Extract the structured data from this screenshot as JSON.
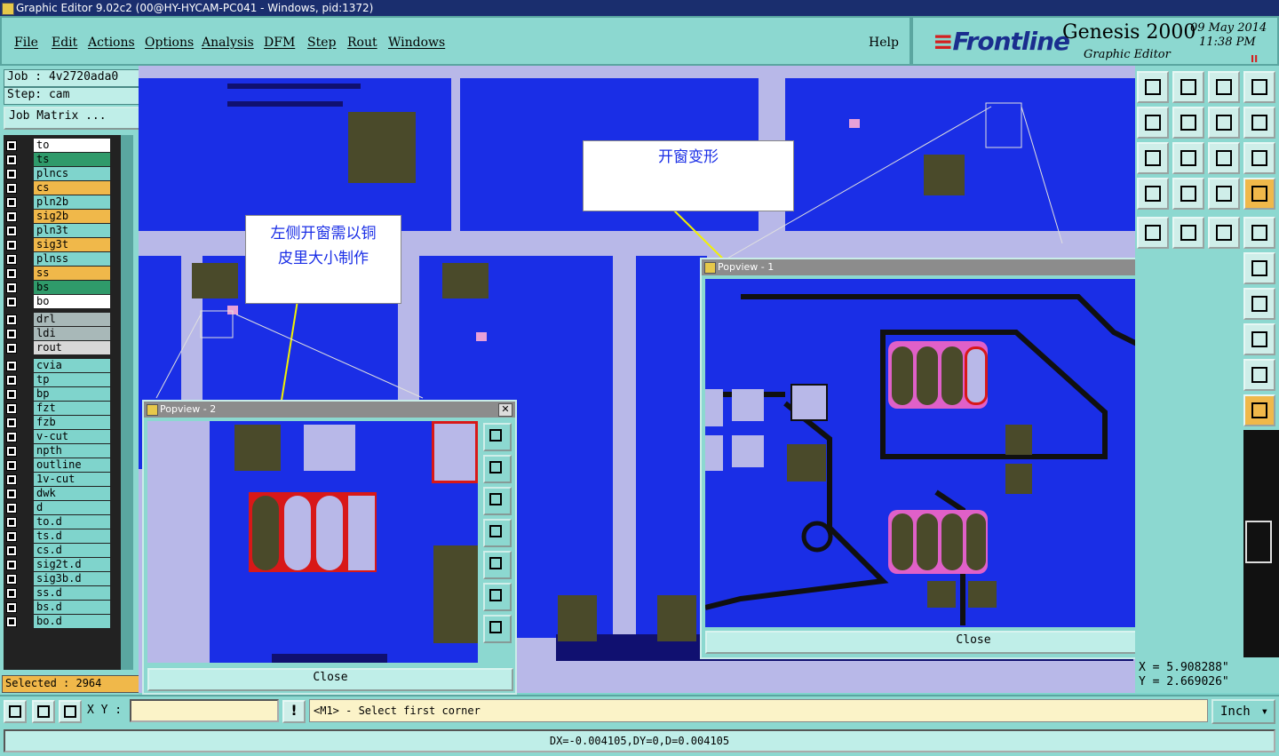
{
  "window": {
    "title": "Graphic Editor 9.02c2 (00@HY-HYCAM-PC041 - Windows, pid:1372)"
  },
  "menu": [
    {
      "label": "File"
    },
    {
      "label": "Edit"
    },
    {
      "label": "Actions"
    },
    {
      "label": "Options"
    },
    {
      "label": "Analysis"
    },
    {
      "label": "DFM"
    },
    {
      "label": "Step"
    },
    {
      "label": "Rout"
    },
    {
      "label": "Windows"
    },
    {
      "label": "Help"
    }
  ],
  "brand": {
    "logo": "Frontline",
    "product": "Genesis 2000",
    "subtitle": "Graphic Editor",
    "date": "09 May 2014",
    "time": "11:38 PM",
    "pause": "II"
  },
  "job": {
    "job_label": "Job : 4v2720ada0",
    "step_label": "Step: cam",
    "matrix_button": "Job Matrix ..."
  },
  "layers": [
    {
      "name": "to",
      "color": "#ffffff"
    },
    {
      "name": "ts",
      "color": "#2f9a6a"
    },
    {
      "name": "plncs",
      "color": "#7fd4cc"
    },
    {
      "name": "cs",
      "color": "#f0b84a"
    },
    {
      "name": "pln2b",
      "color": "#7fd4cc"
    },
    {
      "name": "sig2b",
      "color": "#f0b84a"
    },
    {
      "name": "pln3t",
      "color": "#7fd4cc"
    },
    {
      "name": "sig3t",
      "color": "#f0b84a"
    },
    {
      "name": "plnss",
      "color": "#7fd4cc"
    },
    {
      "name": "ss",
      "color": "#f0b84a"
    },
    {
      "name": "bs",
      "color": "#2f9a6a"
    },
    {
      "name": "bo",
      "color": "#ffffff"
    },
    {
      "name": "drl",
      "color": "#a8b8b8"
    },
    {
      "name": "ldi",
      "color": "#a8b8b8"
    },
    {
      "name": "rout",
      "color": "#d8d8d8"
    },
    {
      "name": "cvia",
      "color": "#7fd4cc"
    },
    {
      "name": "tp",
      "color": "#7fd4cc"
    },
    {
      "name": "bp",
      "color": "#7fd4cc"
    },
    {
      "name": "fzt",
      "color": "#7fd4cc"
    },
    {
      "name": "fzb",
      "color": "#7fd4cc"
    },
    {
      "name": "v-cut",
      "color": "#7fd4cc"
    },
    {
      "name": "npth",
      "color": "#7fd4cc"
    },
    {
      "name": "outline",
      "color": "#7fd4cc"
    },
    {
      "name": "1v-cut",
      "color": "#7fd4cc"
    },
    {
      "name": "dwk",
      "color": "#7fd4cc"
    },
    {
      "name": "d",
      "color": "#7fd4cc"
    },
    {
      "name": "to.d",
      "color": "#7fd4cc"
    },
    {
      "name": "ts.d",
      "color": "#7fd4cc"
    },
    {
      "name": "cs.d",
      "color": "#7fd4cc"
    },
    {
      "name": "sig2t.d",
      "color": "#7fd4cc"
    },
    {
      "name": "sig3b.d",
      "color": "#7fd4cc"
    },
    {
      "name": "ss.d",
      "color": "#7fd4cc"
    },
    {
      "name": "bs.d",
      "color": "#7fd4cc"
    },
    {
      "name": "bo.d",
      "color": "#7fd4cc"
    }
  ],
  "selected": "Selected : 2964",
  "annotations": {
    "note_deform": "开窗变形",
    "note_left_line1": "左侧开窗需以铜",
    "note_left_line2": "皮里大小制作"
  },
  "popview1": {
    "title": "Popview - 1",
    "close_label": "Close",
    "close_x": "✕"
  },
  "popview2": {
    "title": "Popview - 2",
    "close_label": "Close",
    "close_x": "✕"
  },
  "coords": {
    "x": "X =  5.908288\"",
    "y": "Y =  2.669026\""
  },
  "bottom": {
    "xy_label": "X Y :",
    "xy_value": "",
    "warn": "!",
    "prompt": "<M1> - Select first corner",
    "units": "Inch"
  },
  "status": "DX=-0.004105,DY=0,D=0.004105",
  "colors": {
    "board_blue": "#1a2ee6",
    "panel_teal": "#8cd8d0",
    "accent_orange": "#f0b84a",
    "title_navy": "#1a2e6e"
  }
}
